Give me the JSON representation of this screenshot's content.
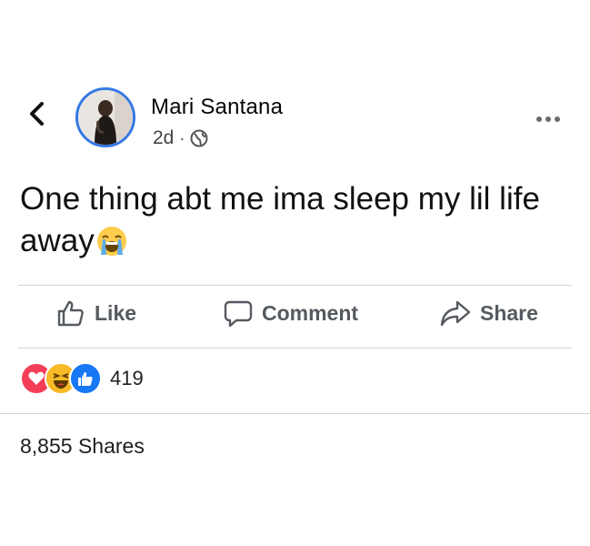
{
  "post": {
    "author": "Mari Santana",
    "age": "2d",
    "separator": "·",
    "privacy_icon": "globe-icon",
    "text": "One thing abt me ima sleep my lil life away",
    "text_emoji": "loudly-crying-face-emoji"
  },
  "actions": {
    "like_label": "Like",
    "comment_label": "Comment",
    "share_label": "Share"
  },
  "reactions": {
    "types": [
      "love",
      "haha",
      "like"
    ],
    "count": "419"
  },
  "shares": {
    "label": "8,855 Shares"
  },
  "colors": {
    "avatar_ring": "#3578e5",
    "love": "#f33e58",
    "haha": "#f7b928",
    "like": "#1877f2",
    "action_text": "#555a60",
    "divider": "#d4d4d4"
  }
}
